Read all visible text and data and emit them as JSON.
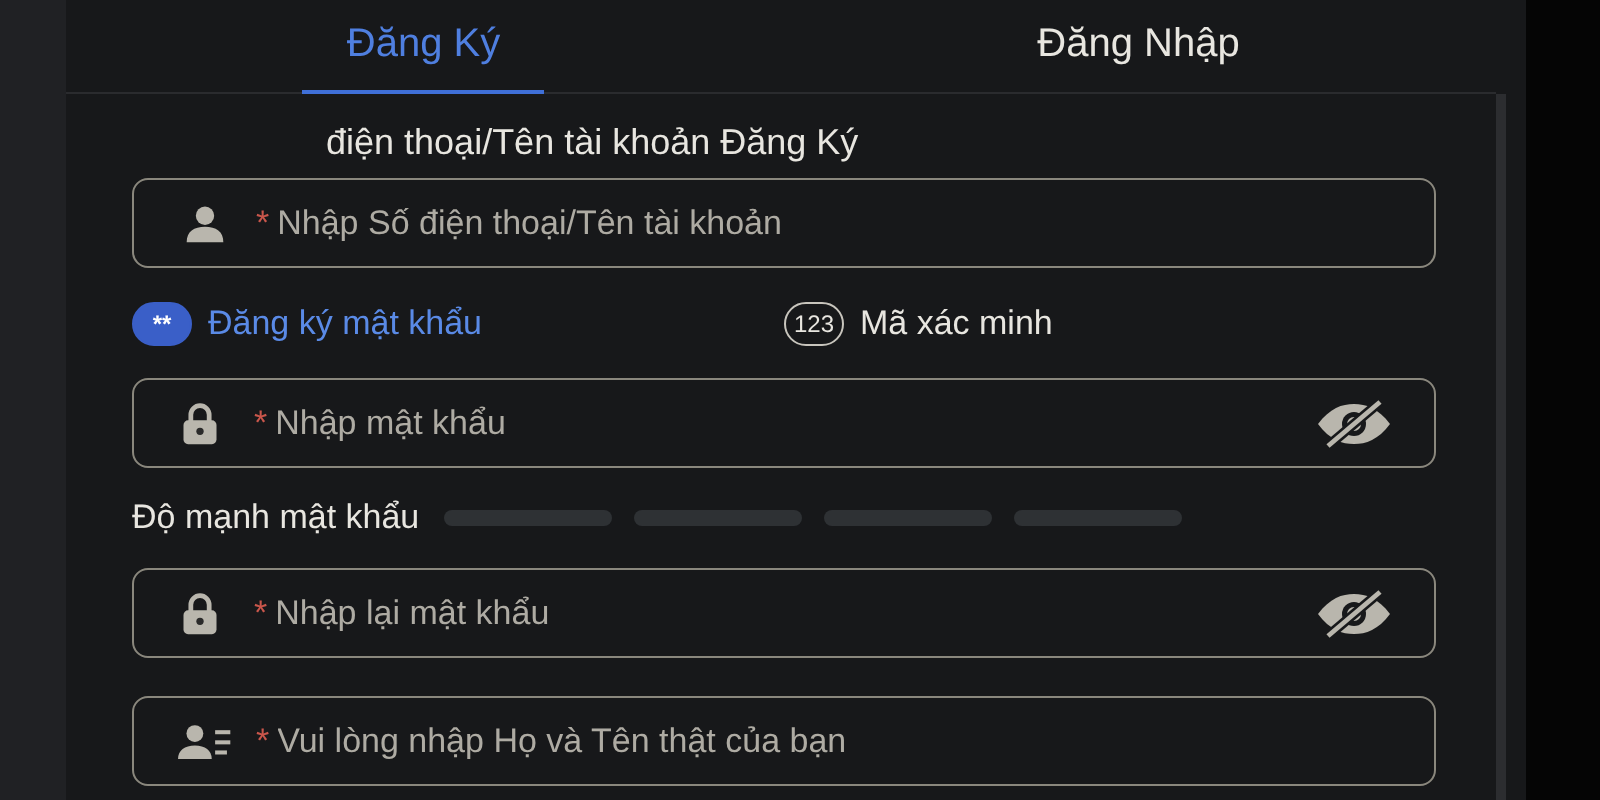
{
  "tabs": [
    {
      "label": "Đăng Ký",
      "selected": true
    },
    {
      "label": "Đăng Nhập",
      "selected": false
    }
  ],
  "account": {
    "label": "điện thoại/Tên tài khoản Đăng Ký",
    "field": {
      "kind": "user",
      "placeholder": "Nhập Số điện thoại/Tên tài khoản",
      "required_mark": "*"
    }
  },
  "methods": [
    {
      "badge": "**",
      "label": "Đăng ký mật khẩu",
      "selected": true
    },
    {
      "badge": "123",
      "label": "Mã xác minh",
      "selected": false
    }
  ],
  "password": {
    "kind": "lock",
    "placeholder": "Nhập mật khẩu",
    "required_mark": "*",
    "password": true
  },
  "strength": {
    "label": "Độ mạnh mật khẩu"
  },
  "fields": [
    {
      "kind": "lock",
      "placeholder": "Nhập lại mật khẩu",
      "required_mark": "*",
      "password": true
    },
    {
      "kind": "id",
      "placeholder": "Vui lòng nhập Họ và Tên thật của bạn",
      "required_mark": "*"
    }
  ]
}
